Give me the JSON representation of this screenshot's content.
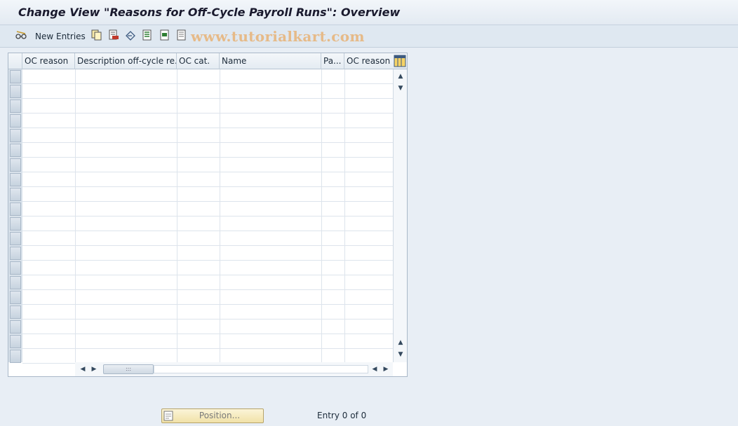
{
  "title": "Change View \"Reasons for Off-Cycle Payroll Runs\": Overview",
  "toolbar": {
    "new_entries_label": "New Entries",
    "icons": [
      "edit-glasses-icon",
      "copy-icon",
      "delete-icon",
      "undo-icon",
      "select-all-icon",
      "select-block-icon",
      "deselect-all-icon"
    ]
  },
  "watermark": "www.tutorialkart.com",
  "table": {
    "columns": [
      "OC reason",
      "Description off-cycle re...",
      "OC cat.",
      "Name",
      "Pa...",
      "OC reason ty"
    ],
    "row_count": 20
  },
  "footer": {
    "position_label": "Position...",
    "entry_text": "Entry 0 of 0"
  },
  "colors": {
    "background": "#e8eef5",
    "toolbar": "#dfe8f1",
    "position_button": "#f1e2a8",
    "watermark": "#e8b276"
  }
}
